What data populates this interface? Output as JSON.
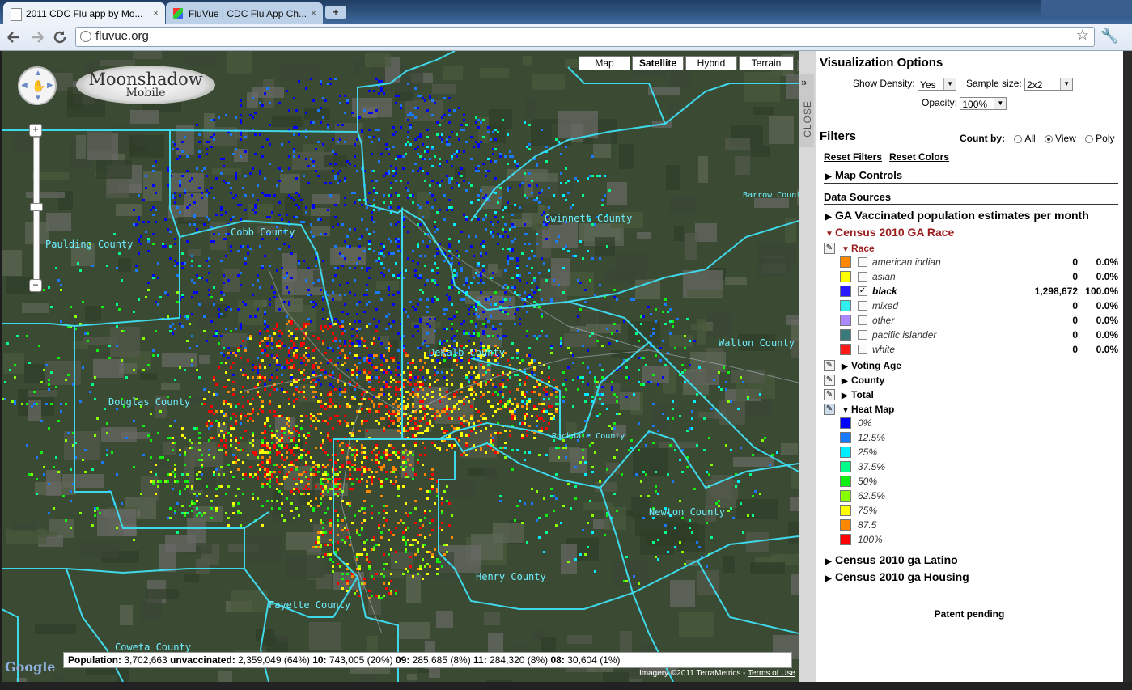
{
  "browser": {
    "tabs": [
      {
        "title": "2011 CDC Flu app by Mo...",
        "active": true
      },
      {
        "title": "FluVue | CDC Flu App Ch...",
        "active": false
      }
    ],
    "close_glyph": "×",
    "new_tab_glyph": "+",
    "url": "fluvue.org",
    "icons": {
      "back": "back-arrow-icon",
      "forward": "forward-arrow-icon",
      "reload": "reload-icon",
      "star": "star-icon",
      "wrench": "wrench-icon",
      "globe": "globe-icon"
    }
  },
  "map": {
    "map_types": [
      {
        "label": "Map",
        "selected": false
      },
      {
        "label": "Satellite",
        "selected": true
      },
      {
        "label": "Hybrid",
        "selected": false
      },
      {
        "label": "Terrain",
        "selected": false
      }
    ],
    "logo": {
      "line1": "Moonshadow",
      "line2": "Mobile"
    },
    "zoom_in": "+",
    "zoom_out": "−",
    "counties": [
      "Paulding County",
      "Cobb County",
      "Gwinnett County",
      "Barrow County",
      "Walton County",
      "Douglas County",
      "DeKalb County",
      "Rockdale County",
      "Newton County",
      "Henry County",
      "Fayette County",
      "Coweta County"
    ],
    "population_bar": {
      "population_label": "Population:",
      "population": "3,702,663",
      "unvaccinated_label": "unvaccinated:",
      "unvaccinated": "2,359,049 (64%)",
      "m10_label": "10:",
      "m10": "743,005 (20%)",
      "m09_label": "09:",
      "m09": "285,685 (8%)",
      "m11_label": "11:",
      "m11": "284,320 (8%)",
      "m08_label": "08:",
      "m08": "30,604 (1%)"
    },
    "google_logo": "Google",
    "imagery": "Imagery ©2011 TerraMetrics - ",
    "terms": "Terms of Use"
  },
  "close_tab": {
    "label": "CLOSE",
    "glyph": "»"
  },
  "panel": {
    "viz_title": "Visualization Options",
    "show_density_label": "Show Density:",
    "show_density_value": "Yes",
    "sample_size_label": "Sample size:",
    "sample_size_value": "2x2",
    "opacity_label": "Opacity:",
    "opacity_value": "100%",
    "filters_title": "Filters",
    "count_by_label": "Count by:",
    "count_by_options": [
      {
        "label": "All",
        "selected": false
      },
      {
        "label": "View",
        "selected": true
      },
      {
        "label": "Poly",
        "selected": false
      }
    ],
    "reset_filters": "Reset Filters",
    "reset_colors": "Reset Colors",
    "map_controls": "Map Controls",
    "data_sources_title": "Data Sources",
    "ds_vaccinated": "GA Vaccinated population estimates per month",
    "ds_race": "Census 2010 GA Race",
    "race_category": "Race",
    "race_items": [
      {
        "name": "american indian",
        "color": "#ff8800",
        "checked": false,
        "count": "0",
        "pct": "0.0%"
      },
      {
        "name": "asian",
        "color": "#ffff00",
        "checked": false,
        "count": "0",
        "pct": "0.0%"
      },
      {
        "name": "black",
        "color": "#2a1aff",
        "checked": true,
        "count": "1,298,672",
        "pct": "100.0%"
      },
      {
        "name": "mixed",
        "color": "#33eeee",
        "checked": false,
        "count": "0",
        "pct": "0.0%"
      },
      {
        "name": "other",
        "color": "#aa88ff",
        "checked": false,
        "count": "0",
        "pct": "0.0%"
      },
      {
        "name": "pacific islander",
        "color": "#3a7a7a",
        "checked": false,
        "count": "0",
        "pct": "0.0%"
      },
      {
        "name": "white",
        "color": "#ff1a1a",
        "checked": false,
        "count": "0",
        "pct": "0.0%"
      }
    ],
    "categories_collapsed": [
      "Voting Age",
      "County",
      "Total"
    ],
    "heat_map_title": "Heat Map",
    "heat_items": [
      {
        "label": "0%",
        "color": "#0000ff"
      },
      {
        "label": "12.5%",
        "color": "#1a7aff"
      },
      {
        "label": "25%",
        "color": "#00eeff"
      },
      {
        "label": "37.5%",
        "color": "#00ff88"
      },
      {
        "label": "50%",
        "color": "#11ee11"
      },
      {
        "label": "62.5%",
        "color": "#88ff00"
      },
      {
        "label": "75%",
        "color": "#ffff00"
      },
      {
        "label": "87.5",
        "color": "#ff8800"
      },
      {
        "label": "100%",
        "color": "#ff0000"
      }
    ],
    "ds_latino": "Census 2010 ga Latino",
    "ds_housing": "Census 2010 ga Housing",
    "patent": "Patent pending",
    "check_glyph": "✓",
    "caret_open": "▼",
    "caret_closed": "▶",
    "pencil_glyph": "✎"
  }
}
